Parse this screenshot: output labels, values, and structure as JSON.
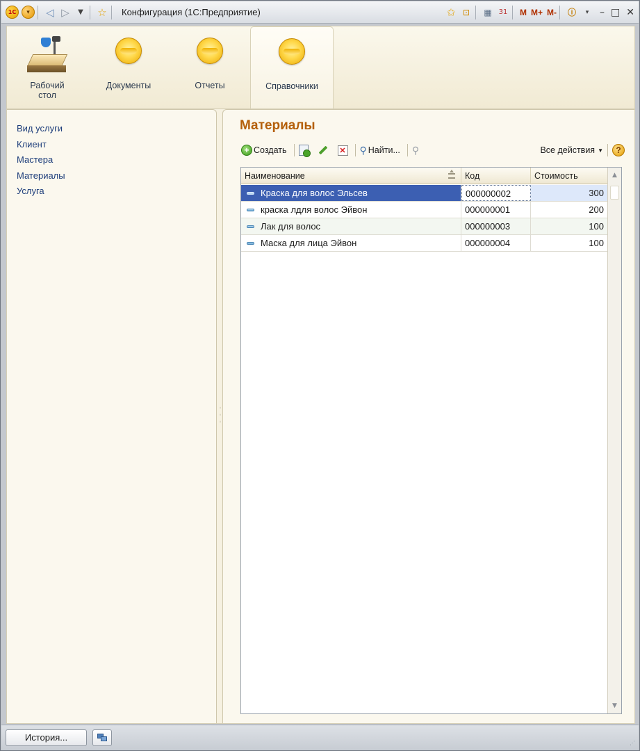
{
  "window": {
    "title": "Конфигурация  (1С:Предприятие)",
    "logo_text": "1С",
    "memory_buttons": [
      "M",
      "M+",
      "M-"
    ]
  },
  "sections": [
    {
      "label": "Рабочий стол",
      "icon": "desktop-icon"
    },
    {
      "label": "Документы",
      "icon": "section-orb-icon"
    },
    {
      "label": "Отчеты",
      "icon": "section-orb-icon"
    },
    {
      "label": "Справочники",
      "icon": "section-orb-icon",
      "active": true
    }
  ],
  "navigation": {
    "items": [
      "Вид услуги",
      "Клиент",
      "Мастера",
      "Материалы",
      "Услуга"
    ]
  },
  "form": {
    "title": "Материалы",
    "toolbar": {
      "create_label": "Создать",
      "find_label": "Найти...",
      "all_actions_label": "Все действия"
    },
    "table": {
      "columns": [
        "Наименование",
        "Код",
        "Стоимость"
      ],
      "rows": [
        {
          "name": "Краска для волос Эльсев",
          "code": "000000002",
          "cost": "300",
          "selected": true
        },
        {
          "name": "краска лдля волос Эйвон",
          "code": "000000001",
          "cost": "200"
        },
        {
          "name": "Лак для волос",
          "code": "000000003",
          "cost": "100"
        },
        {
          "name": "Маска для лица Эйвон",
          "code": "000000004",
          "cost": "100"
        }
      ]
    }
  },
  "statusbar": {
    "history_label": "История..."
  },
  "colors": {
    "accent_title": "#b45f0a",
    "selection": "#3c5fb2",
    "nav_link": "#1d3d7a"
  }
}
